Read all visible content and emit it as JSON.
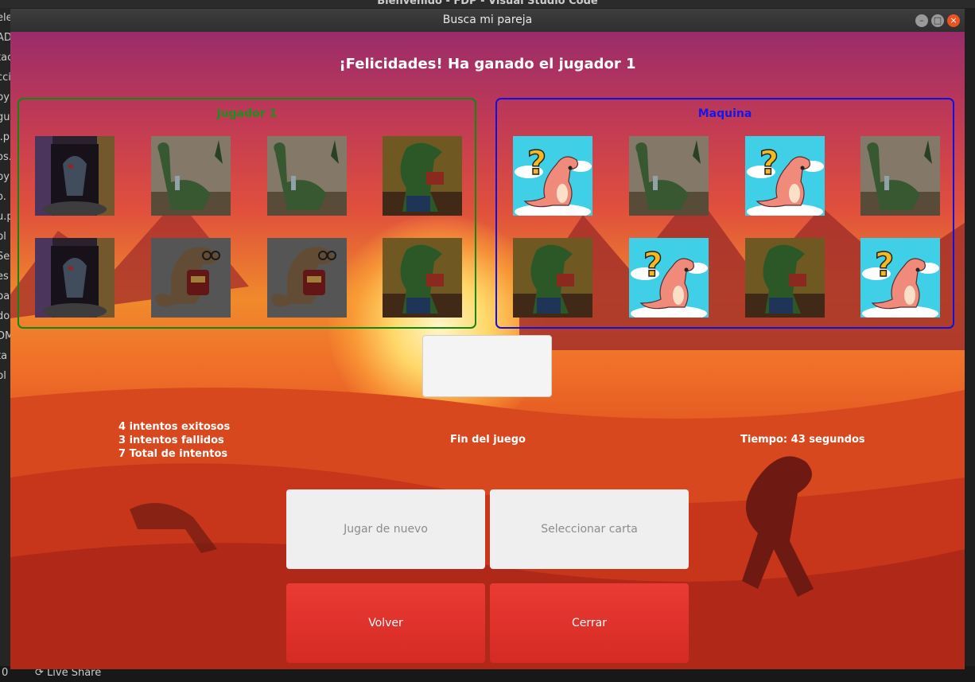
{
  "vscode": {
    "title": "Bienvenido - FDP - Visual Studio Code",
    "sidebar_fragments": [
      "ele",
      "AD",
      "tac",
      "cci",
      "py",
      "gu",
      "l.p",
      "os.",
      "py",
      "o.",
      "u.p",
      "pl",
      "Se",
      "es",
      "pa",
      "do",
      "DM",
      "ta",
      "pl"
    ],
    "status_left": "0",
    "status_live_share": "Live Share"
  },
  "window": {
    "title": "Busca mi pareja"
  },
  "game": {
    "message": "¡Felicidades! Ha ganado el jugador 1",
    "player1": {
      "label": "Jugador 1",
      "cards": [
        "zombie-dino",
        "bottle-dino",
        "bottle-dino",
        "muscle-dino",
        "zombie-dino",
        "nerd-dino",
        "nerd-dino",
        "muscle-dino"
      ],
      "matched": [
        true,
        true,
        true,
        true,
        true,
        true,
        true,
        true
      ]
    },
    "machine": {
      "label": "Maquina",
      "cards": [
        "question-dino",
        "bottle-dino",
        "question-dino",
        "bottle-dino",
        "muscle-dino",
        "question-dino",
        "muscle-dino",
        "question-dino"
      ],
      "matched": [
        false,
        true,
        false,
        true,
        true,
        false,
        true,
        false
      ]
    },
    "stats": {
      "successful": "4 intentos exitosos",
      "failed": "3 intentos fallidos",
      "total": "7 Total de intentos"
    },
    "status": "Fin del juego",
    "timer": "Tiempo: 43 segundos"
  },
  "buttons": {
    "play_again": "Jugar de nuevo",
    "select_card": "Seleccionar carta",
    "back": "Volver",
    "close": "Cerrar"
  },
  "colors": {
    "player1_border": "#128712",
    "machine_border": "#1010e0",
    "button_red": "#e0322c",
    "button_light": "#efefef"
  }
}
